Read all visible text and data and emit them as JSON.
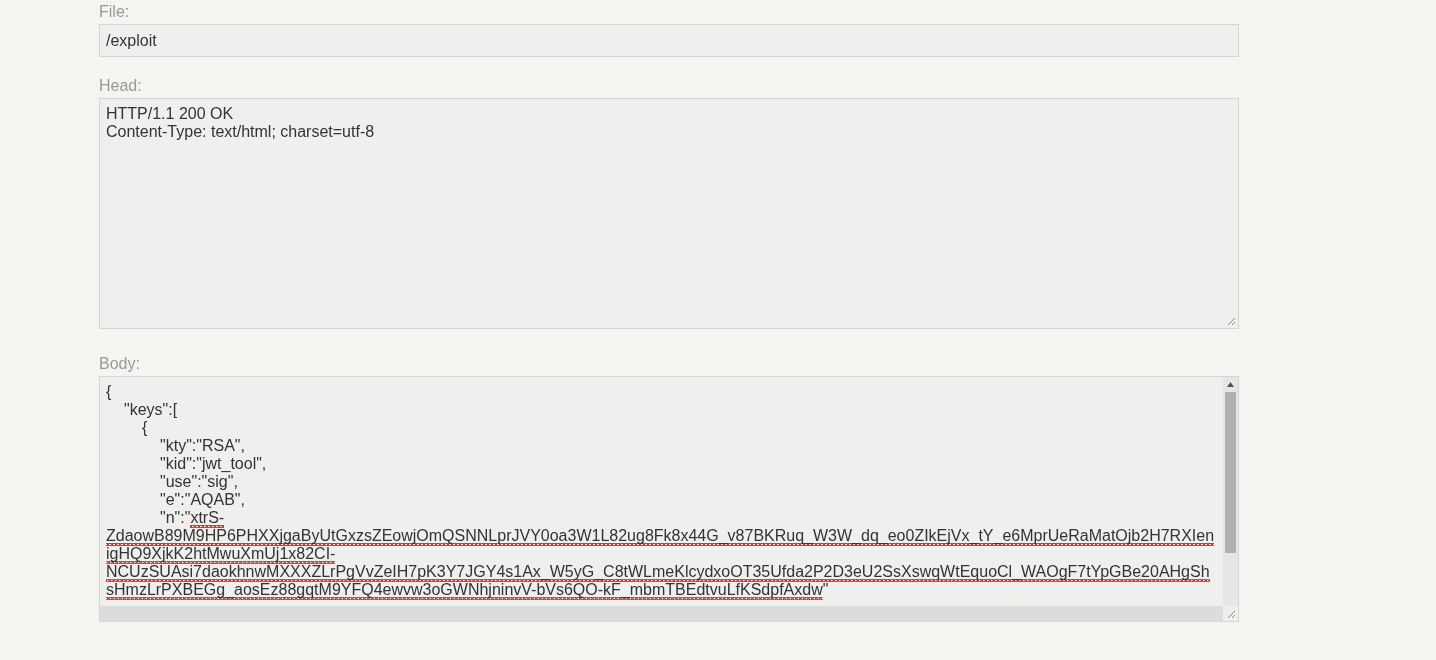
{
  "file": {
    "label": "File:",
    "value": "/exploit"
  },
  "head": {
    "label": "Head:",
    "lines": [
      "HTTP/1.1 200 OK",
      "Content-Type: text/html; charset=utf-8"
    ]
  },
  "body": {
    "label": "Body:",
    "lines": [
      [
        {
          "text": "{",
          "misspelled": false
        }
      ],
      [
        {
          "text": "\t\"keys\":[",
          "misspelled": false
        }
      ],
      [
        {
          "text": "\t\t{",
          "misspelled": false
        }
      ],
      [
        {
          "text": "\t\t\t\"kty\":\"RSA\",",
          "misspelled": false
        }
      ],
      [
        {
          "text": "\t\t\t\"kid\":\"jwt_tool\",",
          "misspelled": false
        }
      ],
      [
        {
          "text": "\t\t\t\"use\":\"sig\",",
          "misspelled": false
        }
      ],
      [
        {
          "text": "\t\t\t\"e\":\"AQAB\",",
          "misspelled": false
        }
      ],
      [
        {
          "text": "\t\t\t\"n\":\"",
          "misspelled": false
        },
        {
          "text": "xtrS-",
          "misspelled": true
        }
      ],
      [
        {
          "text": "ZdaowB89M9HP6PHXXjgaByUtGxzsZEowjOmQSNNLprJVY0oa3W1L82ug8Fk8x44G_v87BKRuq_W3W_dq_eo0ZIkEjVx_tY_e6MprUeRaMatOjb2H7RXIen",
          "misspelled": true
        }
      ],
      [
        {
          "text": "igHQ9XjkK2htMwuXmUj1x82CI-",
          "misspelled": true
        }
      ],
      [
        {
          "text": "NCUzSUAsi7daokhnwMXXXZLrPgVvZeIH7pK3Y7JGY4s1Ax_W5yG_C8tWLmeKlcydxoOT35Ufda2P2D3eU2SsXswqWtEquoCl_WAOgF7tYpGBe20AHgSh",
          "misspelled": true
        }
      ],
      [
        {
          "text": "sHmzLrPXBEGg_aosEz88gqtM9YFQ4ewvw3oGWNhjninvV-bVs6QO-kF_mbmTBEdtvuLfKSdpfAxdw",
          "misspelled": true
        },
        {
          "text": "\"",
          "misspelled": false
        }
      ]
    ]
  }
}
